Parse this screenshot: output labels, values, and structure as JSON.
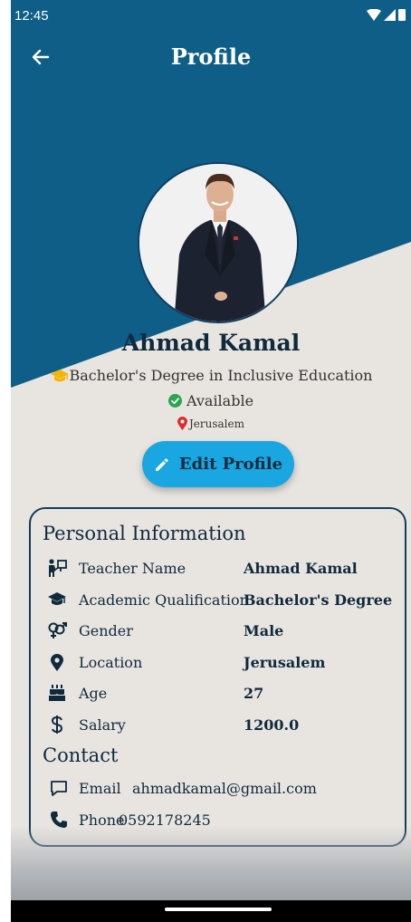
{
  "status_bar": {
    "time": "12:45"
  },
  "header": {
    "title": "Profile"
  },
  "profile": {
    "name": "Ahmad Kamal",
    "degree": "Bachelor's Degree in Inclusive Education",
    "availability": "Available",
    "location": "Jerusalem",
    "edit_label": "Edit Profile"
  },
  "personal": {
    "title": "Personal Information",
    "rows": [
      {
        "icon": "teacher-icon",
        "label": "Teacher Name",
        "value": "Ahmad Kamal"
      },
      {
        "icon": "graduation-cap-icon",
        "label": "Academic Qualification",
        "value": "Bachelor's Degree"
      },
      {
        "icon": "gender-icon",
        "label": "Gender",
        "value": "Male"
      },
      {
        "icon": "location-pin-icon",
        "label": "Location",
        "value": "Jerusalem"
      },
      {
        "icon": "cake-icon",
        "label": "Age",
        "value": "27"
      },
      {
        "icon": "dollar-icon",
        "label": "Salary",
        "value": "1200.0"
      }
    ]
  },
  "contact": {
    "title": "Contact",
    "email_label": "Email",
    "email": "ahmadkamal@gmail.com",
    "phone_label": "Phone",
    "phone": "0592178245"
  },
  "colors": {
    "header": "#0e5e88",
    "background": "#e8e4e0",
    "accent": "#1aa6e0",
    "text": "#0f2a3d"
  }
}
